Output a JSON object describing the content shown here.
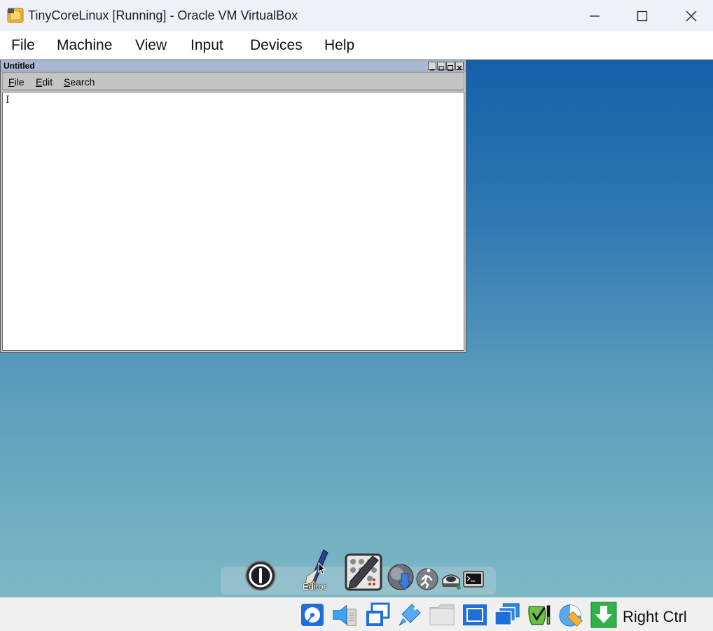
{
  "window": {
    "title": "TinyCoreLinux [Running] - Oracle VM VirtualBox",
    "controls": [
      "minimize-icon",
      "maximize-icon",
      "close-icon"
    ]
  },
  "menubar": {
    "items": [
      "File",
      "Machine",
      "View",
      "Input",
      "Devices",
      "Help"
    ]
  },
  "editor": {
    "title": "Untitled",
    "menu": [
      "File",
      "Edit",
      "Search"
    ],
    "menu_shortcuts": [
      "F",
      "E",
      "S"
    ],
    "menu_rest": [
      "ile",
      "dit",
      "earch"
    ],
    "cursor": "I"
  },
  "dock": {
    "hover_label": "Editor",
    "icons": [
      "power-icon",
      "editor-icon",
      "control-panel-icon",
      "apps-icon",
      "run-icon",
      "mount-icon",
      "terminal-icon"
    ]
  },
  "statusbar": {
    "icons": [
      "hard-disk-icon",
      "optical-drive-icon",
      "network-icon",
      "usb-icon",
      "shared-folder-icon",
      "display-icon",
      "recording-icon",
      "guest-additions-icon",
      "cpu-icon",
      "mouse-integration-icon"
    ],
    "host_key": "Right Ctrl"
  },
  "colors": {
    "desktop_top": "#1560a8",
    "desktop_bottom": "#7db8c4",
    "accent_blue": "#1e6fd9"
  }
}
